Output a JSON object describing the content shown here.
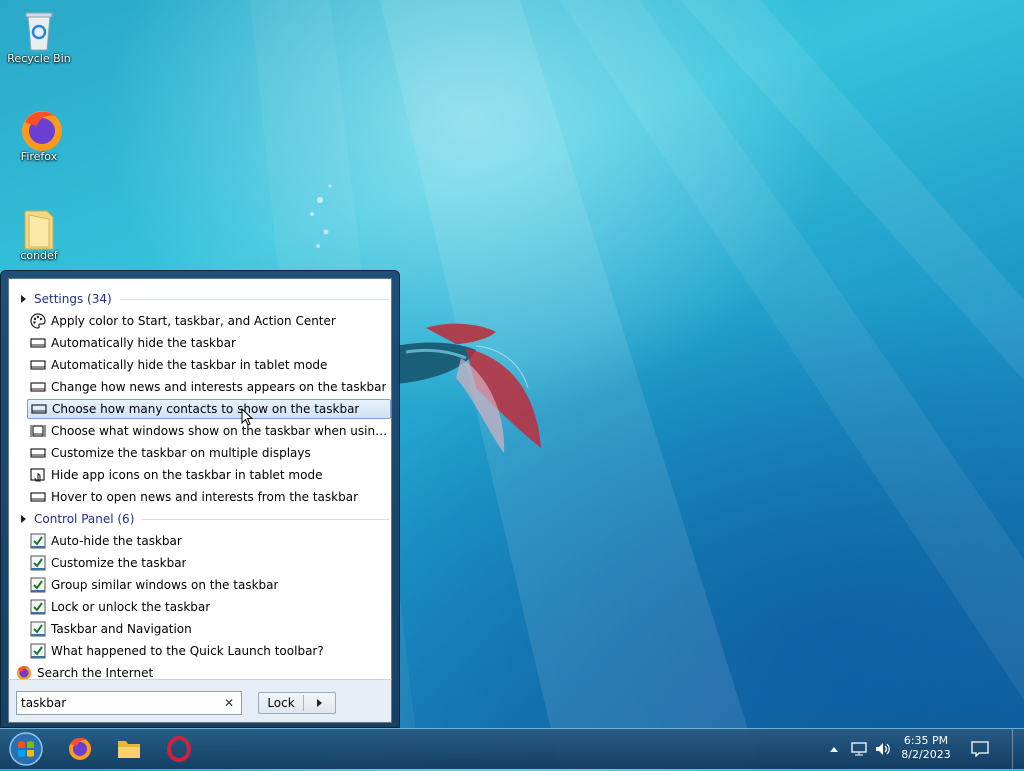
{
  "desktop": {
    "icons": [
      {
        "label": "Recycle Bin",
        "icon": "recycle-bin-icon"
      },
      {
        "label": "Firefox",
        "icon": "firefox-icon"
      },
      {
        "label": "condef",
        "icon": "folder-icon"
      }
    ]
  },
  "start_menu": {
    "groups": [
      {
        "header": "Settings (34)",
        "items": [
          {
            "label": "Apply color to Start, taskbar, and Action Center",
            "icon": "palette-icon"
          },
          {
            "label": "Automatically hide the taskbar",
            "icon": "taskbar-icon"
          },
          {
            "label": "Automatically hide the taskbar in tablet mode",
            "icon": "taskbar-icon"
          },
          {
            "label": "Change how news and interests appears on the taskbar",
            "icon": "taskbar-icon"
          },
          {
            "label": "Choose how many contacts to show on the taskbar",
            "icon": "taskbar-icon",
            "highlighted": true
          },
          {
            "label": "Choose what windows show on the taskbar when using virtual...",
            "icon": "virtual-desktop-icon"
          },
          {
            "label": "Customize the taskbar on multiple displays",
            "icon": "taskbar-icon"
          },
          {
            "label": "Hide app icons on the taskbar in tablet mode",
            "icon": "tablet-touch-icon"
          },
          {
            "label": "Hover to open news and interests from the taskbar",
            "icon": "taskbar-icon"
          }
        ]
      },
      {
        "header": "Control Panel (6)",
        "items": [
          {
            "label": "Auto-hide the taskbar",
            "icon": "checklist-icon"
          },
          {
            "label": "Customize the taskbar",
            "icon": "checklist-icon"
          },
          {
            "label": "Group similar windows on the taskbar",
            "icon": "checklist-icon"
          },
          {
            "label": "Lock or unlock the taskbar",
            "icon": "checklist-icon"
          },
          {
            "label": "Taskbar and Navigation",
            "icon": "checklist-icon"
          },
          {
            "label": "What happened to the Quick Launch toolbar?",
            "icon": "checklist-icon"
          }
        ]
      }
    ],
    "search_internet": "Search the Internet",
    "search": {
      "value": "taskbar",
      "clear_symbol": "✕"
    },
    "lock_button": "Lock"
  },
  "taskbar": {
    "pinned": [
      "firefox-icon",
      "file-explorer-icon",
      "opera-icon"
    ],
    "time": "6:35 PM",
    "date": "8/2/2023"
  },
  "colors": {
    "group_header": "#1e3287",
    "highlight_border": "#7da2ce",
    "menu_frame": "#1f4f78"
  }
}
